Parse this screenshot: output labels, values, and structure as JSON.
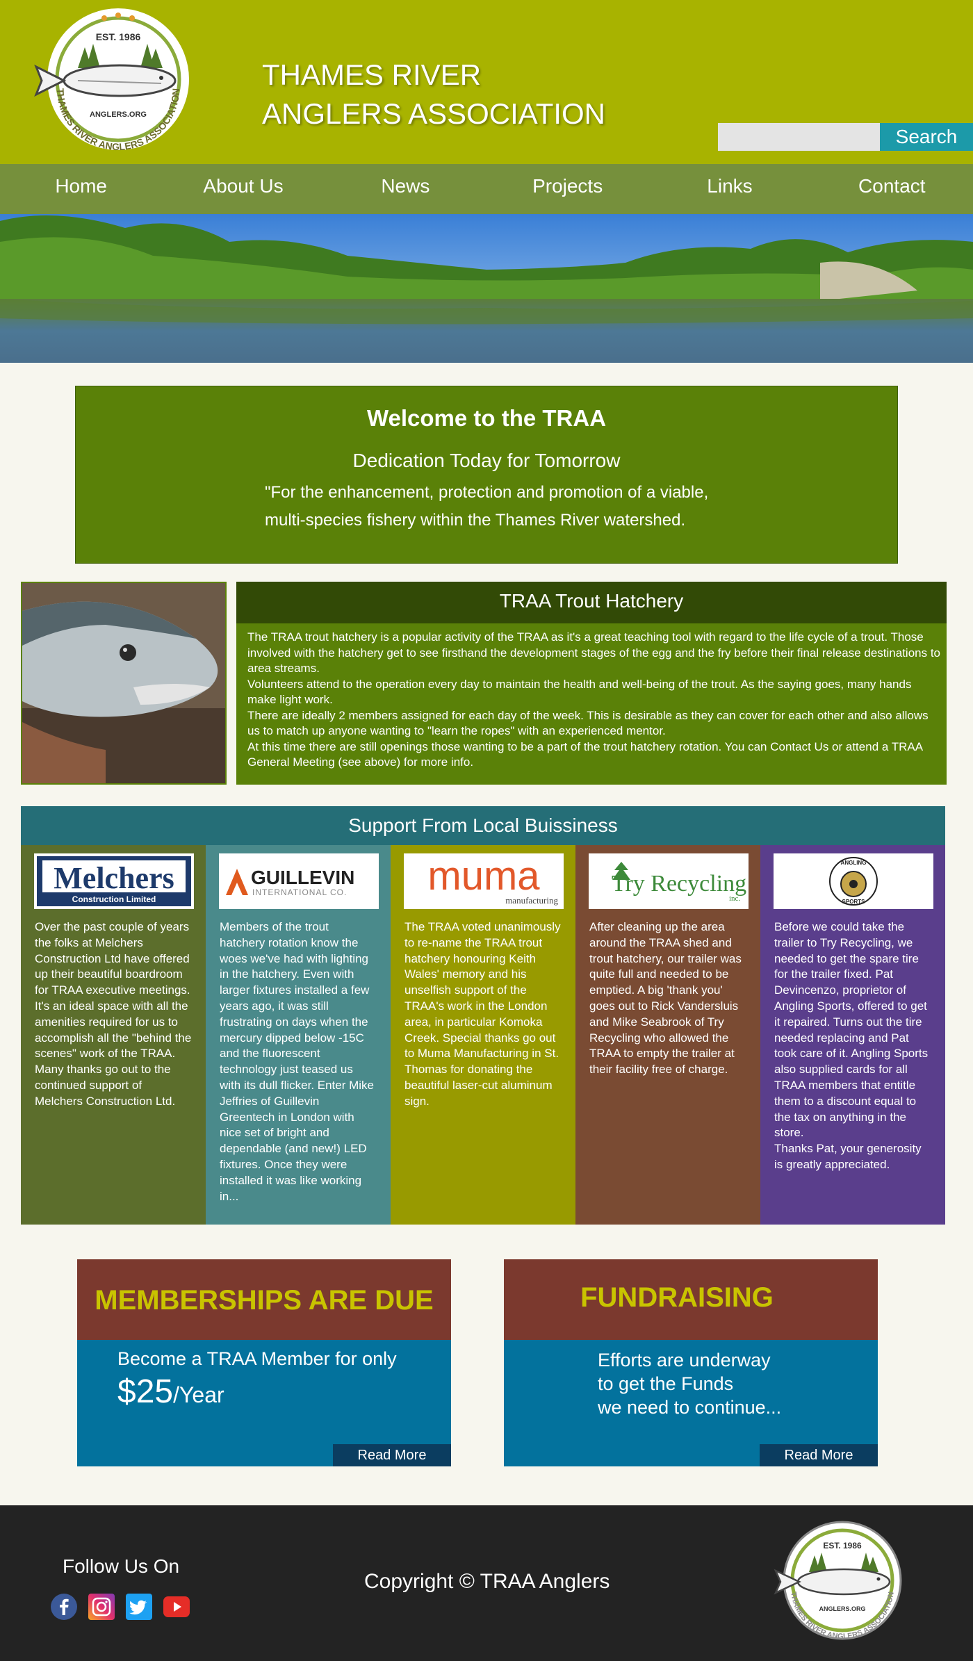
{
  "header": {
    "logo_text_top": "EST. 1986",
    "logo_text_mid": "ANGLERS.ORG",
    "logo_text_ring": "THAMES RIVER ANGLERS ASSOCIATION",
    "title_line1": "THAMES RIVER",
    "title_line2": "ANGLERS ASSOCIATION",
    "search": {
      "placeholder": "",
      "button_label": "Search"
    }
  },
  "nav": {
    "items": [
      {
        "label": "Home"
      },
      {
        "label": "About Us"
      },
      {
        "label": "News"
      },
      {
        "label": "Projects"
      },
      {
        "label": "Links"
      },
      {
        "label": "Contact"
      }
    ]
  },
  "welcome": {
    "title": "Welcome to the TRAA",
    "subtitle": "Dedication Today for Tomorrow",
    "quote_line1": "\"For the enhancement, protection and promotion of a viable,",
    "quote_line2": "multi-species fishery within the Thames River watershed."
  },
  "hatchery": {
    "title": "TRAA Trout Hatchery",
    "paragraphs": [
      "The TRAA trout hatchery is a popular activity of the TRAA as it's a great teaching tool with regard to the life cycle of a trout. Those involved with the hatchery get to see firsthand the development stages of the egg and the fry before their final release destinations to area streams.",
      "Volunteers attend to the operation every day to maintain the health and well-being of the trout. As the saying goes, many hands make light work.",
      "There are ideally 2 members assigned for each day of the week. This is desirable as they can cover for each other and also allows us to match up anyone wanting to \"learn the ropes\" with an experienced mentor.",
      "At this time there are still openings those wanting to be a part of the trout hatchery rotation. You can Contact Us or attend a TRAA General Meeting (see above) for more info."
    ]
  },
  "support": {
    "title": "Support From Local Buissiness",
    "columns": [
      {
        "logo_text": "Melchers",
        "logo_sub": "Construction Limited",
        "text": "Over the past couple of years the folks at Melchers Construction Ltd have offered up their beautiful boardroom for TRAA executive meetings. It's an ideal space with all the amenities required for us to accomplish all the \"behind the scenes\" work of the TRAA. Many thanks go out to the continued support of Melchers Construction Ltd.",
        "color": "#5c6e2c"
      },
      {
        "logo_text": "GUILLEVIN",
        "logo_sub": "INTERNATIONAL CO.",
        "text": "Members of the trout hatchery rotation know the woes we've had with lighting in the hatchery. Even with larger fixtures installed a few years ago, it was still frustrating on days when the mercury dipped below -15C and the fluorescent technology just teased us with its dull flicker. Enter Mike Jeffries of Guillevin Greentech in London with nice set of bright and dependable (and new!) LED fixtures. Once they were installed it was like working in...",
        "color": "#4a8a8b"
      },
      {
        "logo_text": "muma",
        "logo_sub": "manufacturing",
        "text": "The TRAA voted unanimously to re-name the TRAA trout hatchery honouring Keith Wales' memory and his unselfish support of the TRAA's work in the London area, in particular Komoka Creek. Special thanks go out to Muma Manufacturing in St. Thomas for donating the beautiful laser-cut aluminum sign.",
        "color": "#989a00"
      },
      {
        "logo_text": "Try Recycling",
        "logo_sub": "inc.",
        "text": "After cleaning up the area around the TRAA shed and trout hatchery, our trailer was quite full and needed to be emptied. A big 'thank you' goes out to Rick Vandersluis and Mike Seabrook of Try Recycling who allowed the TRAA to empty the trailer at their facility free of charge.",
        "color": "#7a4b33"
      },
      {
        "logo_text": "ANGLING",
        "logo_sub": "SPORTS",
        "text": "Before we could take the trailer to Try Recycling, we needed to get the spare tire for the trailer fixed. Pat Devincenzo, proprietor of Angling Sports, offered to get it repaired. Turns out the tire needed replacing and Pat took care of it. Angling Sports also supplied cards for all TRAA members that entitle them to a discount equal to the tax on anything in the store.",
        "text2": "Thanks Pat, your generosity is greatly appreciated.",
        "color": "#5a3e8c"
      }
    ]
  },
  "membership": {
    "heading": "MEMBERSHIPS ARE DUE",
    "line1": "Become a TRAA  Member for only",
    "price": "$25",
    "per": "/Year",
    "read_more": "Read More"
  },
  "fundraising": {
    "heading": "FUNDRAISING",
    "lines": [
      "Efforts are underway",
      "to get the Funds",
      "we need to continue..."
    ],
    "read_more": "Read More"
  },
  "footer": {
    "follow": "Follow Us On",
    "copyright": "Copyright © TRAA Anglers",
    "socials": [
      "facebook-icon",
      "instagram-icon",
      "twitter-icon",
      "youtube-icon"
    ]
  }
}
